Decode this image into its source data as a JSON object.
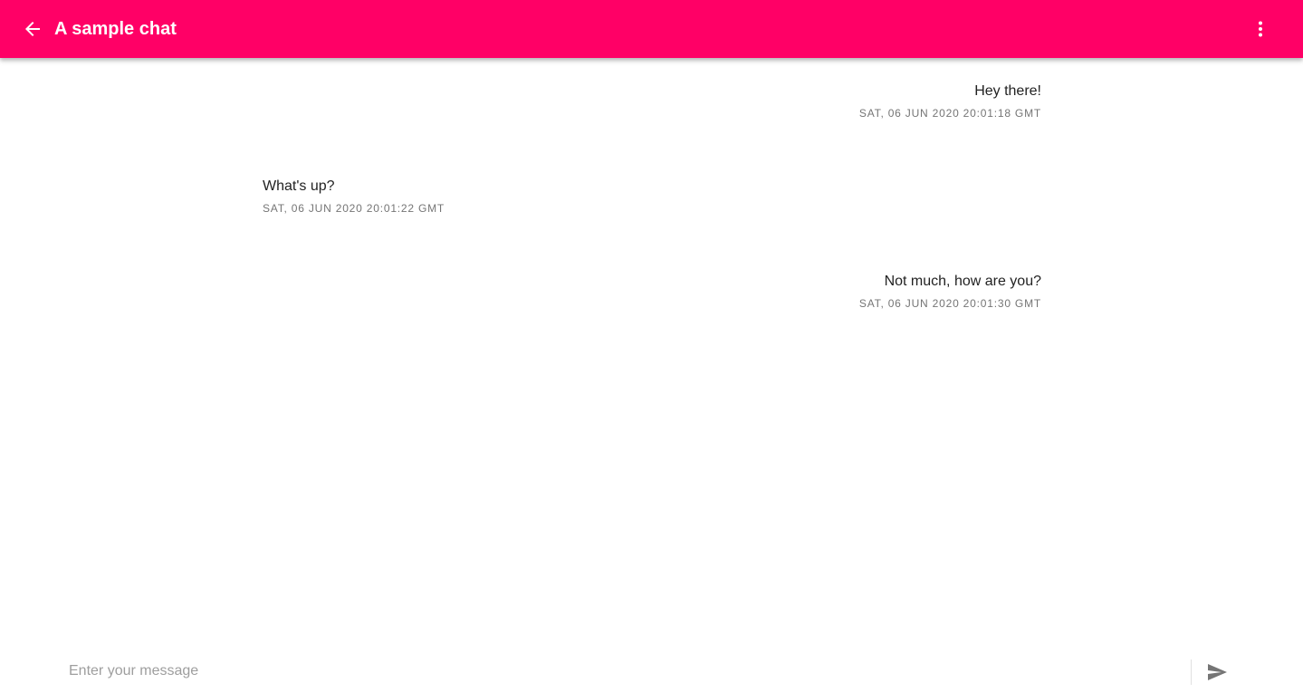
{
  "toolbar": {
    "title": "A sample chat",
    "back_icon": "arrow-left-icon",
    "menu_icon": "more-vertical-icon",
    "color": "#ff0066"
  },
  "messages": [
    {
      "text": "Hey there!",
      "time": "SAT, 06 JUN 2020 20:01:18 GMT",
      "side": "right"
    },
    {
      "text": "What's up?",
      "time": "SAT, 06 JUN 2020 20:01:22 GMT",
      "side": "left"
    },
    {
      "text": "Not much, how are you?",
      "time": "SAT, 06 JUN 2020 20:01:30 GMT",
      "side": "right"
    }
  ],
  "composer": {
    "placeholder": "Enter your message",
    "value": "",
    "send_icon": "send-icon"
  }
}
